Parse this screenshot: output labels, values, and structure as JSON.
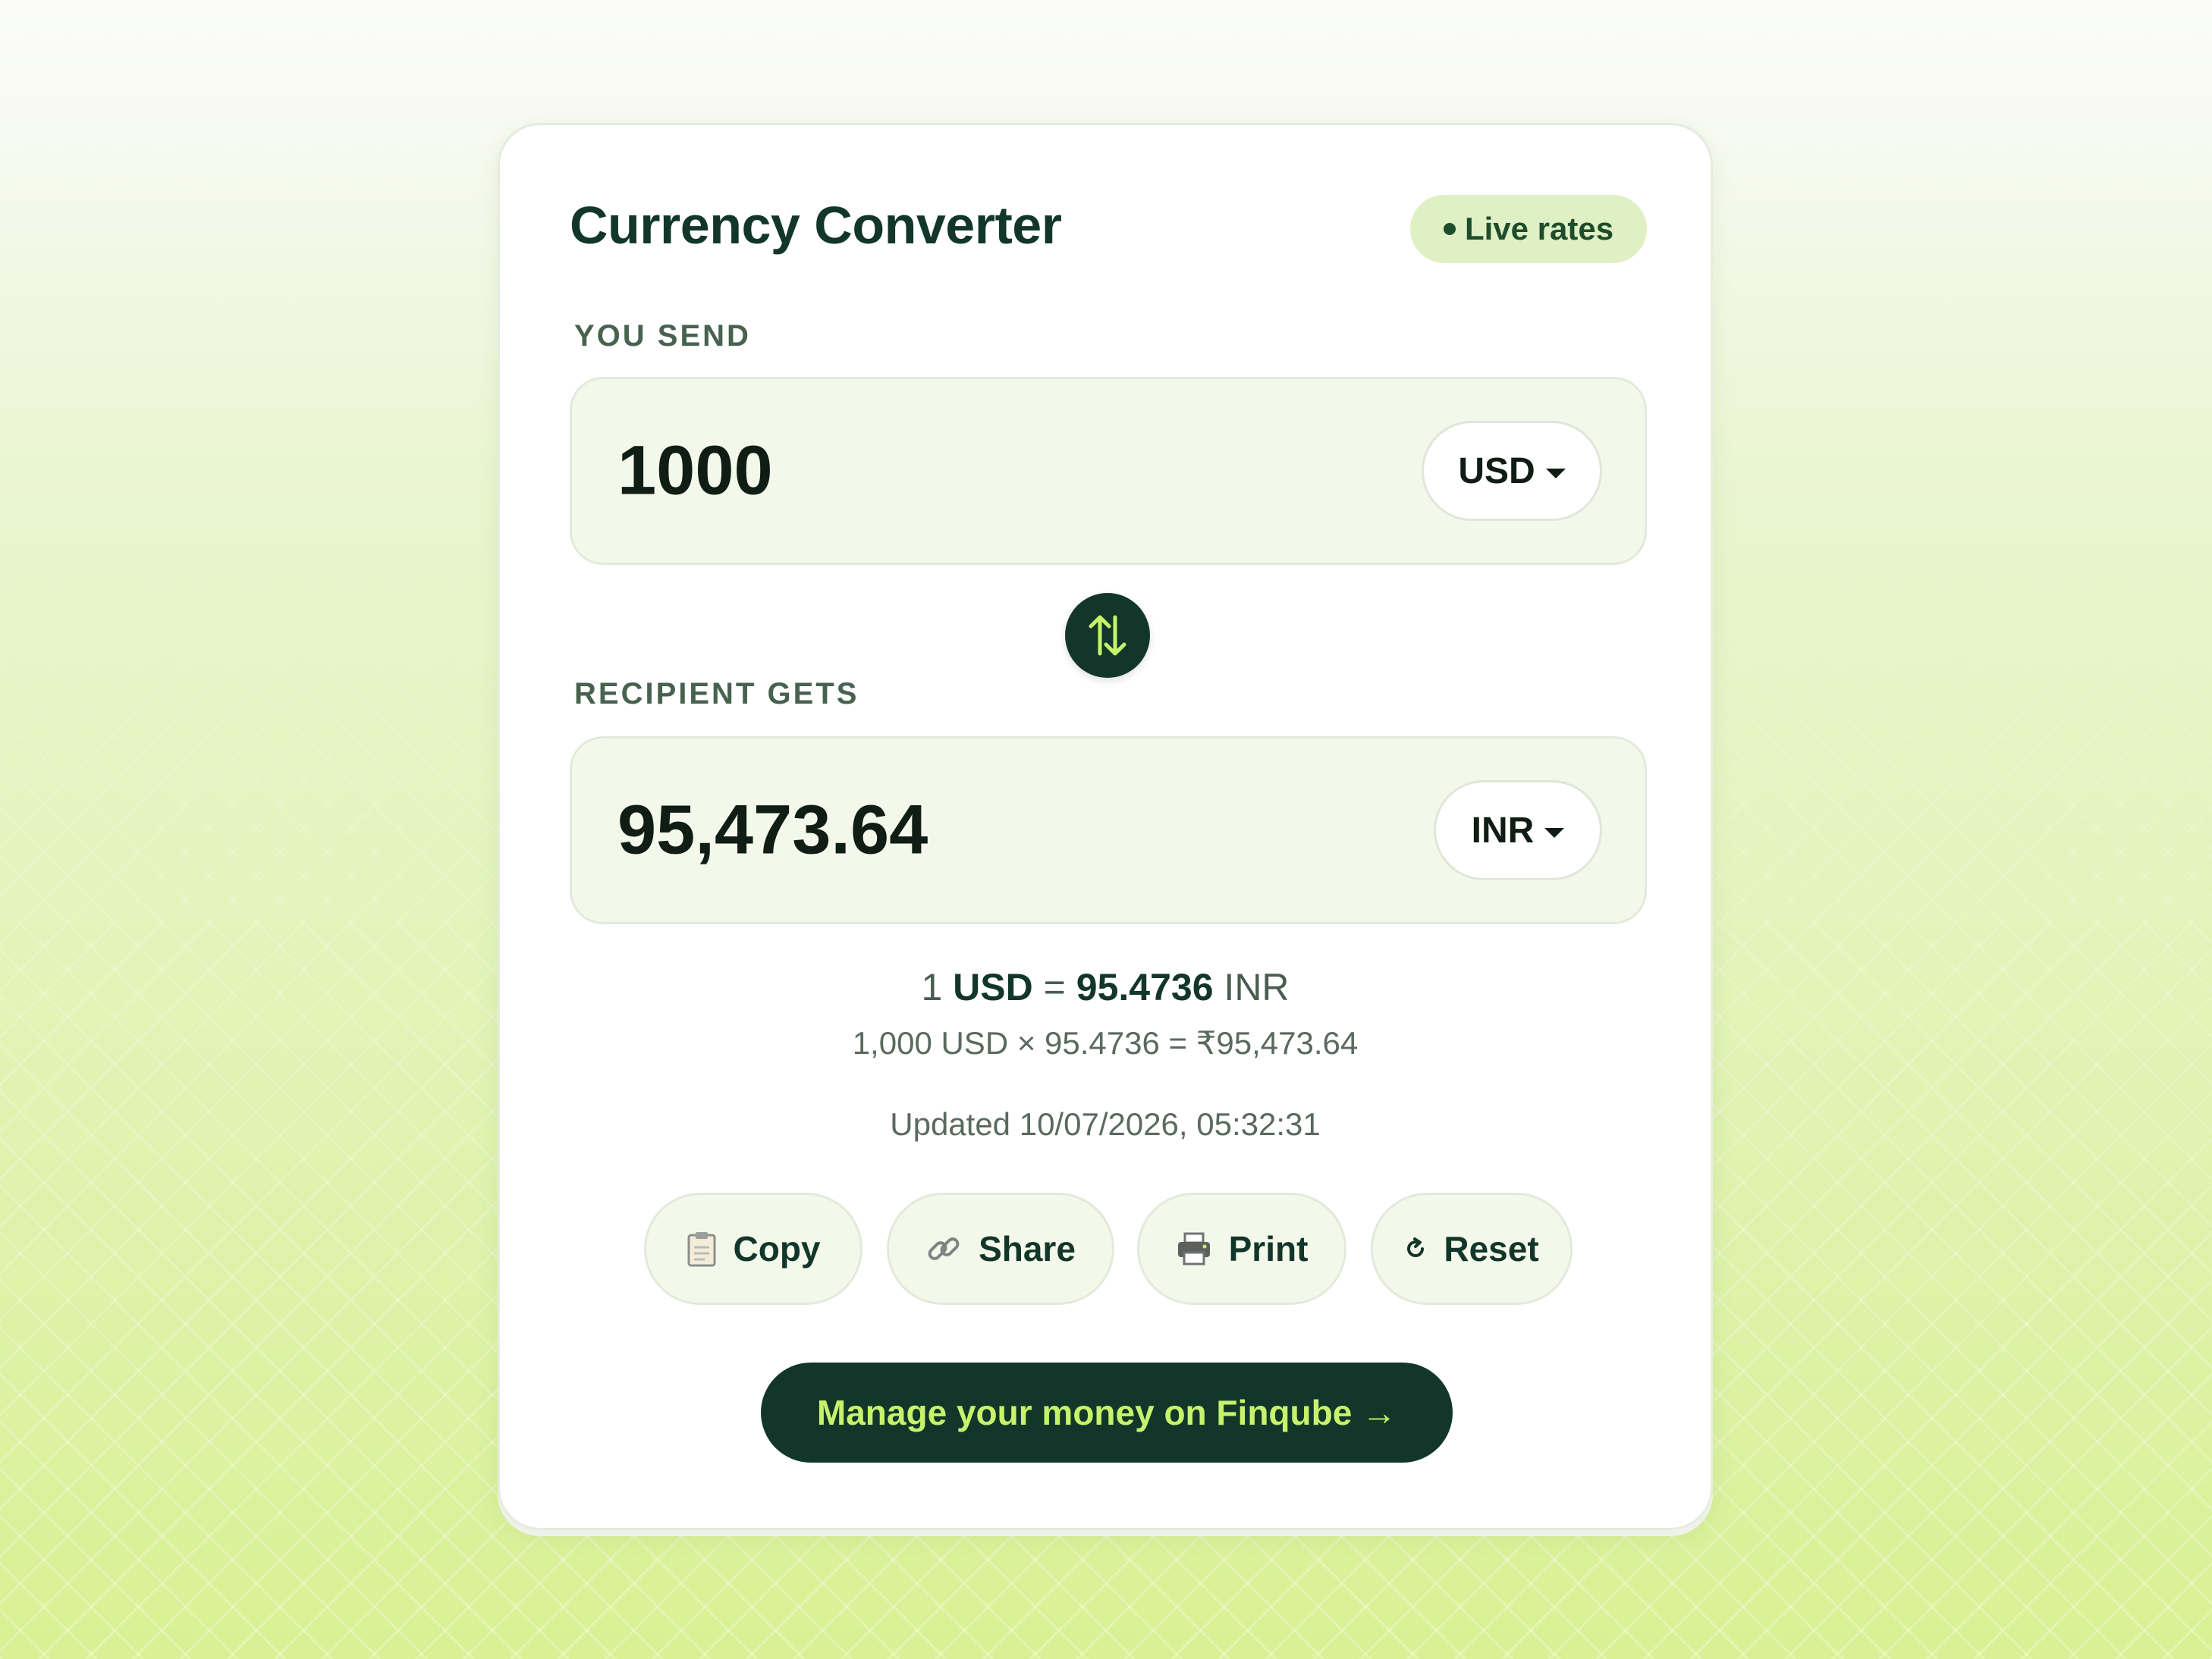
{
  "header": {
    "title": "Currency Converter",
    "badge": "Live rates"
  },
  "send": {
    "label": "YOU SEND",
    "amount": "1000",
    "currency": "USD"
  },
  "receive": {
    "label": "RECIPIENT GETS",
    "amount": "95,473.64",
    "currency": "INR"
  },
  "rate": {
    "base_amount": "1",
    "base_currency": "USD",
    "equals": "=",
    "value": "95.4736",
    "quote_currency": "INR",
    "calculation": "1,000 USD × 95.4736 = ₹95,473.64",
    "updated": "Updated 10/07/2026, 05:32:31"
  },
  "actions": {
    "copy": "Copy",
    "share": "Share",
    "print": "Print",
    "reset": "Reset"
  },
  "cta": {
    "label": "Manage your money on Finqube →"
  },
  "icons": {
    "swap": "swap-vertical-icon",
    "copy": "clipboard-icon",
    "share": "link-icon",
    "print": "printer-icon",
    "reset": "reset-icon"
  },
  "colors": {
    "primary_dark": "#12372a",
    "accent_lime": "#c7f36b",
    "badge_bg": "#dff0c4",
    "field_bg": "#f4f8eb"
  }
}
